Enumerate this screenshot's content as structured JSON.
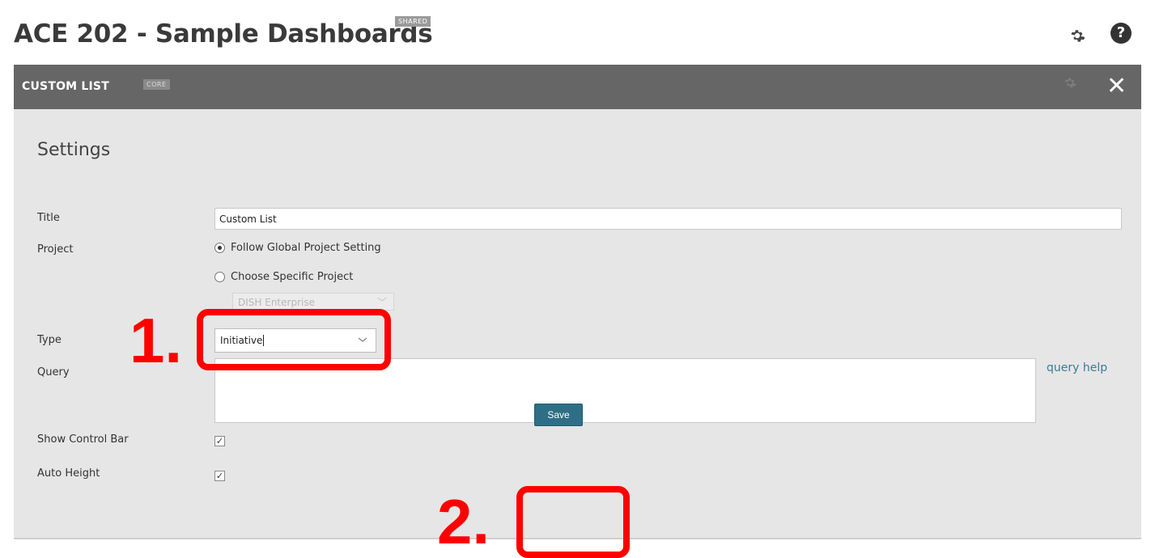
{
  "header": {
    "title": "ACE 202 - Sample Dashboards",
    "badge": "SHARED",
    "help_glyph": "?"
  },
  "panel": {
    "title": "CUSTOM LIST",
    "badge": "CORE",
    "close_glyph": "✕"
  },
  "settings": {
    "heading": "Settings",
    "title_label": "Title",
    "title_value": "Custom List",
    "project_label": "Project",
    "project_options": [
      {
        "label": "Follow Global Project Setting",
        "selected": true
      },
      {
        "label": "Choose Specific Project",
        "selected": false
      }
    ],
    "project_select_value": "DISH Enterprise",
    "type_label": "Type",
    "type_value": "Initiative",
    "query_label": "Query",
    "query_value": "",
    "query_help": "query help",
    "show_control_bar_label": "Show Control Bar",
    "show_control_bar_checked": true,
    "auto_height_label": "Auto Height",
    "auto_height_checked": true,
    "save_label": "Save",
    "check_glyph": "✓"
  },
  "annotations": {
    "step1": "1.",
    "step2": "2.",
    "color": "#ff0000"
  },
  "colors": {
    "panel_bar": "#666666",
    "panel_body": "#e6e6e6",
    "save_button": "#2f6f86",
    "link": "#3d7a99"
  }
}
